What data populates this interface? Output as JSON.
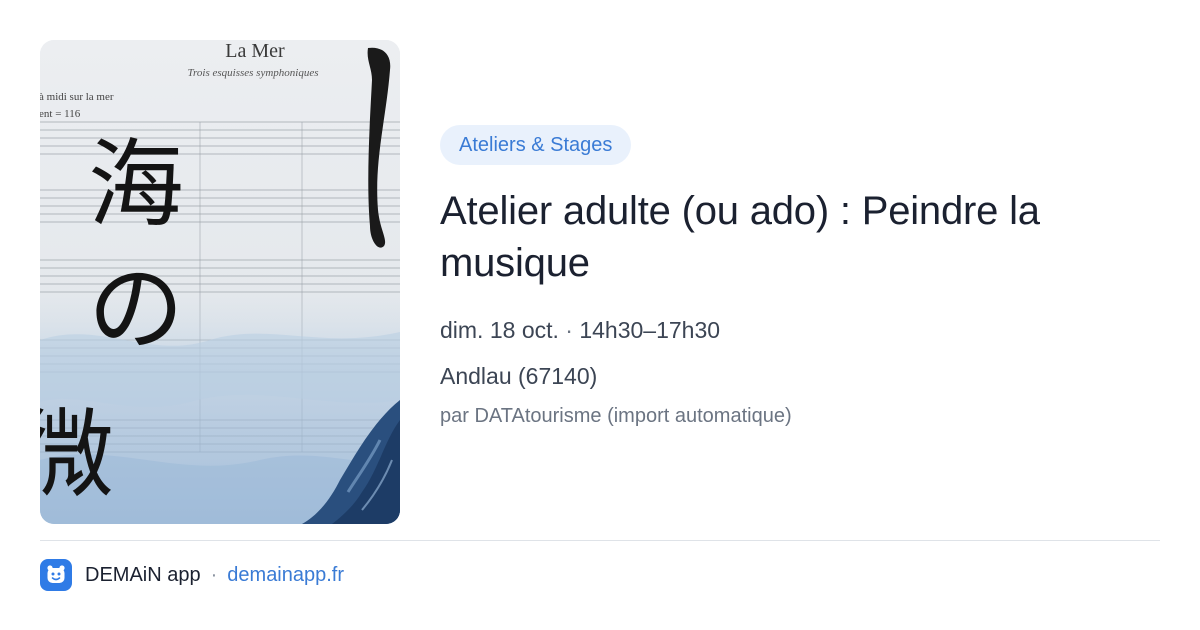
{
  "card": {
    "image": {
      "score_title": "La Mer",
      "score_subtitle": "Trois esquisses symphoniques",
      "score_movement": "à midi sur la mer",
      "score_tempo": "ent  = 116",
      "calligraphy_1": "海",
      "calligraphy_2": "の",
      "calligraphy_3": "微"
    },
    "category": "Ateliers & Stages",
    "title": "Atelier adulte (ou ado) : Peindre la musique",
    "date": "dim. 18 oct.",
    "separator": "·",
    "time": "14h30–17h30",
    "location": "Andlau (67140)",
    "source": "par DATAtourisme (import automatique)"
  },
  "footer": {
    "app_name": "DEMAiN app",
    "separator": "·",
    "domain": "demainapp.fr"
  },
  "colors": {
    "accent": "#3a7bd5",
    "badge_bg": "#e9f1fc",
    "title": "#1b2130",
    "muted": "#6b7482",
    "app_icon": "#2f7be6"
  }
}
